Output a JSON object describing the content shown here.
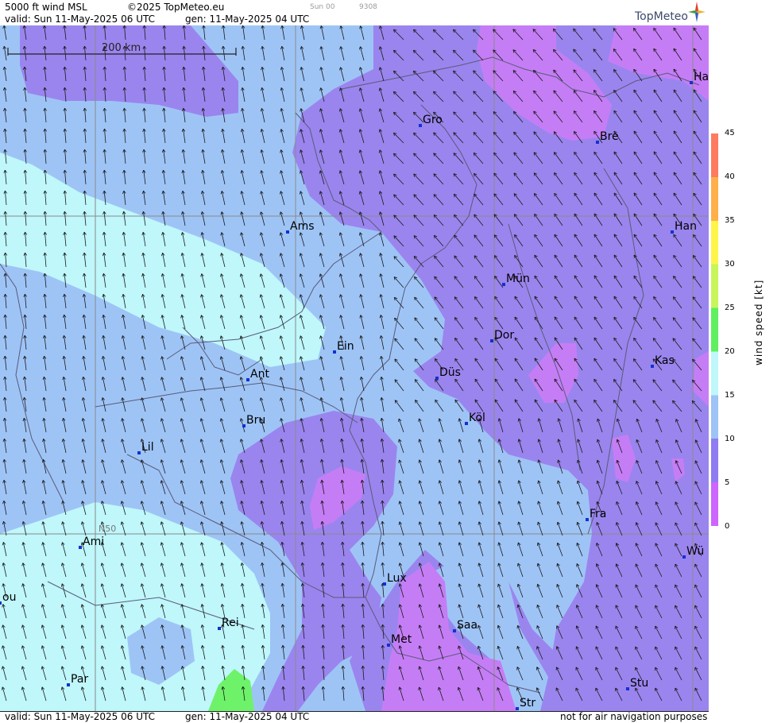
{
  "header": {
    "title": "5000 ft wind MSL",
    "copyright": "©2025 TopMeteo.eu",
    "faint_label_1": "Sun 00",
    "faint_label_2": "9308",
    "valid": "valid:  Sun  11-May-2025  06 UTC",
    "gen": "gen: 11-May-2025 04 UTC",
    "logo": "TopMeteo"
  },
  "footer": {
    "valid": "valid:  Sun  11-May-2025  06 UTC",
    "gen": "gen: 11-May-2025 04 UTC",
    "disclaimer": "not for air navigation purposes"
  },
  "map": {
    "scale_label": "200 km",
    "lat_label": "N50",
    "cities": [
      {
        "name": "Gro"
      },
      {
        "name": "Bre"
      },
      {
        "name": "Ha"
      },
      {
        "name": "Ams"
      },
      {
        "name": "Han"
      },
      {
        "name": "Mün"
      },
      {
        "name": "Dor"
      },
      {
        "name": "Ein"
      },
      {
        "name": "Ant"
      },
      {
        "name": "Düs"
      },
      {
        "name": "Kas"
      },
      {
        "name": "Bru"
      },
      {
        "name": "Köl"
      },
      {
        "name": "Lil"
      },
      {
        "name": "Fra"
      },
      {
        "name": "Ami"
      },
      {
        "name": "Wü"
      },
      {
        "name": "Lux"
      },
      {
        "name": "ou"
      },
      {
        "name": "Rei"
      },
      {
        "name": "Saa"
      },
      {
        "name": "Met"
      },
      {
        "name": "Par"
      },
      {
        "name": "Stu"
      },
      {
        "name": "Str"
      }
    ]
  },
  "legend": {
    "title": "wind speed [kt]",
    "ticks": [
      "45",
      "40",
      "35",
      "30",
      "25",
      "20",
      "15",
      "10",
      "5",
      "0"
    ],
    "colors": [
      "#cc66ff",
      "#8f7cf2",
      "#9dc3f7",
      "#bff7fb",
      "#5ef05e",
      "#c8f55a",
      "#fff44a",
      "#ffb04a",
      "#ff7a60"
    ]
  },
  "colors": {
    "band_lt5": "#c57df6",
    "band_5_10": "#9a85ee",
    "band_10_15": "#9ec4f6",
    "band_15_20": "#bff7fb",
    "band_20_25": "#6ef26a",
    "point_marker": "#1530d0"
  }
}
